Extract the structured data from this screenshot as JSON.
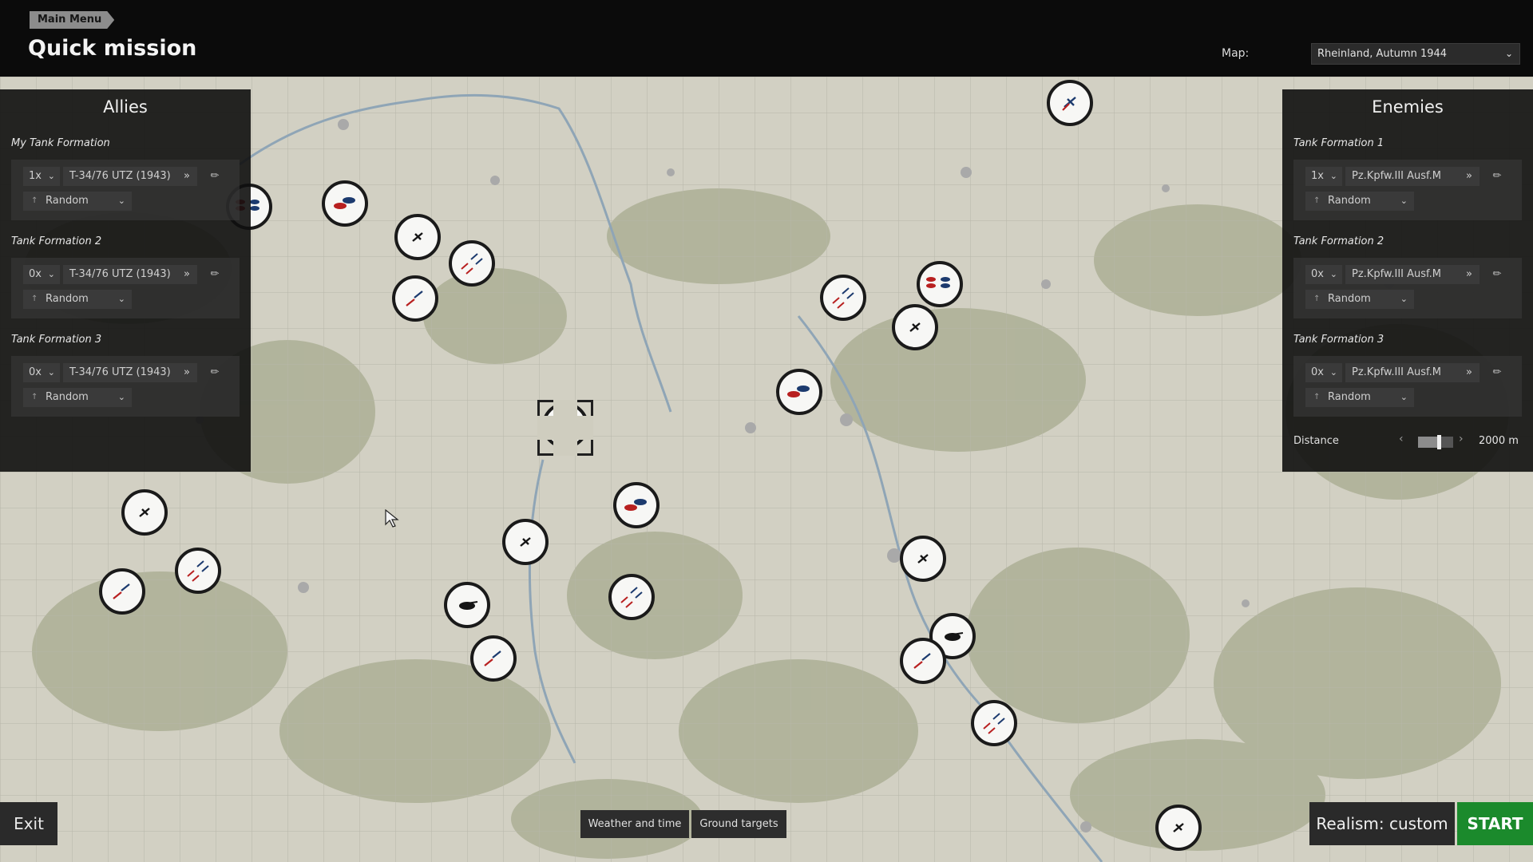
{
  "header": {
    "breadcrumb": "Main Menu",
    "title": "Quick mission",
    "map_label": "Map:",
    "map_value": "Rheinland, Autumn 1944"
  },
  "allies": {
    "title": "Allies",
    "formations": [
      {
        "label": "My Tank Formation",
        "qty": "1x",
        "vehicle": "T-34/76 UTZ (1943)",
        "position": "Random"
      },
      {
        "label": "Tank Formation 2",
        "qty": "0x",
        "vehicle": "T-34/76 UTZ (1943)",
        "position": "Random"
      },
      {
        "label": "Tank Formation 3",
        "qty": "0x",
        "vehicle": "T-34/76 UTZ (1943)",
        "position": "Random"
      }
    ]
  },
  "enemies": {
    "title": "Enemies",
    "formations": [
      {
        "label": "Tank Formation 1",
        "qty": "1x",
        "vehicle": "Pz.Kpfw.III Ausf.M",
        "position": "Random"
      },
      {
        "label": "Tank Formation 2",
        "qty": "0x",
        "vehicle": "Pz.Kpfw.III Ausf.M",
        "position": "Random"
      },
      {
        "label": "Tank Formation 3",
        "qty": "0x",
        "vehicle": "Pz.Kpfw.III Ausf.M",
        "position": "Random"
      }
    ],
    "distance_label": "Distance",
    "distance_value": "2000 m",
    "distance_fraction": 0.6
  },
  "buttons": {
    "exit": "Exit",
    "weather": "Weather and time",
    "ground": "Ground targets",
    "realism": "Realism: custom",
    "start": "START"
  },
  "icons": {
    "chevron": "chevron-down-icon",
    "double_chevron": "double-chevron-icon",
    "wrench": "wrench-icon",
    "position": "position-icon"
  },
  "colors": {
    "start": "#1b8a2c",
    "map": "#cfcdbf",
    "allied": "#b82020",
    "enemy": "#1c3a6e"
  },
  "markers": [
    {
      "type": "plane"
    },
    {
      "type": "tank-duel"
    },
    {
      "type": "plane"
    },
    {
      "type": "fighters"
    },
    {
      "type": "fighter-duel"
    },
    {
      "type": "tank-column"
    },
    {
      "type": "fighters"
    },
    {
      "type": "tank-column"
    },
    {
      "type": "plane"
    },
    {
      "type": "tank-duel"
    },
    {
      "type": "tank-column-selected"
    },
    {
      "type": "tank-duel"
    },
    {
      "type": "plane"
    },
    {
      "type": "fighters"
    },
    {
      "type": "fighter-duel"
    },
    {
      "type": "plane"
    },
    {
      "type": "tank-single"
    },
    {
      "type": "fighters"
    },
    {
      "type": "fighter-duel"
    },
    {
      "type": "plane"
    },
    {
      "type": "tank-single"
    },
    {
      "type": "fighter-duel"
    },
    {
      "type": "fighters"
    },
    {
      "type": "plane"
    }
  ]
}
